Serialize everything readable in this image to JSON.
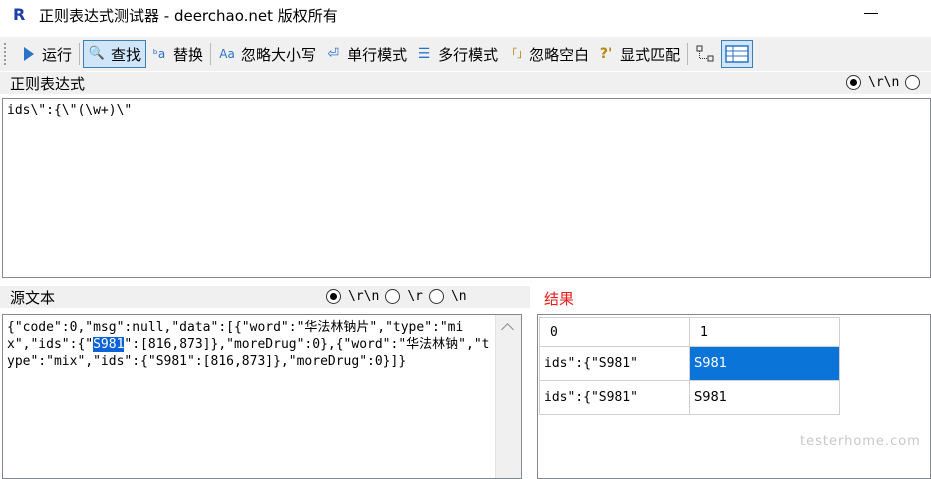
{
  "window": {
    "app_icon": "R",
    "title": "正则表达式测试器 - deerchao.net 版权所有"
  },
  "toolbar": {
    "items": [
      {
        "label": "运行",
        "icon": "run-icon"
      },
      {
        "label": "查找",
        "icon": "find-icon"
      },
      {
        "label": "替换",
        "icon": "replace-icon"
      },
      {
        "label": "忽略大小写",
        "icon": "ignore-case-icon"
      },
      {
        "label": "单行模式",
        "icon": "single-line-icon"
      },
      {
        "label": "多行模式",
        "icon": "multi-line-icon"
      },
      {
        "label": "忽略空白",
        "icon": "ignore-whitespace-icon"
      },
      {
        "label": "显式匹配",
        "icon": "explicit-capture-icon"
      }
    ],
    "icon_glyphs": {
      "find": "🔍",
      "replace": "ᵇa",
      "ignore_case": "Aa",
      "single_line": "⏎",
      "multi_line": "☰",
      "ignore_ws": "「」",
      "explicit": "?'"
    }
  },
  "regex": {
    "header": "正则表达式",
    "newline_option": "\\r\\n",
    "value": "ids\\\":{\\\"(\\w+)\\\""
  },
  "source": {
    "header": "源文本",
    "newline_options": [
      "\\r\\n",
      "\\r",
      "\\n"
    ],
    "text_before": "{\"code\":0,\"msg\":null,\"data\":[{\"word\":\"华法林钠片\",\"type\":\"mix\",\"ids\":{\"",
    "text_highlight": "S981",
    "text_after": "\":[816,873]},\"moreDrug\":0},{\"word\":\"华法林钠\",\"type\":\"mix\",\"ids\":{\"S981\":[816,873]},\"moreDrug\":0}]}"
  },
  "result": {
    "title": "结果",
    "columns": [
      "0",
      "1"
    ],
    "rows": [
      [
        "ids\":{\"S981\"",
        "S981"
      ],
      [
        "ids\":{\"S981\"",
        "S981"
      ]
    ]
  },
  "colors": {
    "selection": "#0a74d8",
    "result_title": "#e81c1c"
  },
  "watermark": "testerhome.com"
}
